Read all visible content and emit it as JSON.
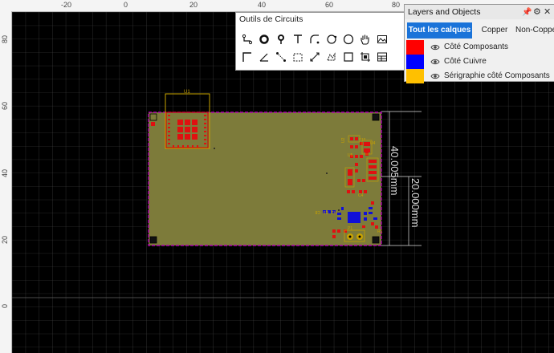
{
  "ruler": {
    "top_ticks": [
      "-20",
      "0",
      "20",
      "40",
      "60",
      "80"
    ],
    "left_ticks": [
      "80",
      "60",
      "40",
      "20",
      "0"
    ]
  },
  "tools_panel": {
    "title": "Outils de Circuits",
    "tools": [
      {
        "name": "wire-tool",
        "icon": "wire-icon"
      },
      {
        "name": "pad-tool",
        "icon": "ring-icon"
      },
      {
        "name": "via-tool",
        "icon": "via-icon"
      },
      {
        "name": "text-tool",
        "icon": "text-icon"
      },
      {
        "name": "arc-tool",
        "icon": "arc-icon"
      },
      {
        "name": "circle-tool",
        "icon": "circle-icon"
      },
      {
        "name": "filled-circle-tool",
        "icon": "circle-outline-icon"
      },
      {
        "name": "pan-tool",
        "icon": "hand-icon"
      },
      {
        "name": "image-tool",
        "icon": "image-icon"
      },
      {
        "name": "line-tool",
        "icon": "corner-line-icon"
      },
      {
        "name": "angle-tool",
        "icon": "angle-icon"
      },
      {
        "name": "measure-tool",
        "icon": "measure-icon"
      },
      {
        "name": "select-area-tool",
        "icon": "select-rect-icon"
      },
      {
        "name": "dimension-tool",
        "icon": "dimension-icon"
      },
      {
        "name": "copper-area-tool",
        "icon": "area-icon"
      },
      {
        "name": "rect-tool",
        "icon": "rect-icon"
      },
      {
        "name": "crop-tool",
        "icon": "crop-icon"
      },
      {
        "name": "table-tool",
        "icon": "table-icon"
      }
    ]
  },
  "layers_panel": {
    "title": "Layers and Objects",
    "tabs": [
      "Tout les calques",
      "Copper",
      "Non-Copper"
    ],
    "active_tab": 0,
    "layers": [
      {
        "label": "Côté Composants",
        "color": "#ff0000"
      },
      {
        "label": "Côté Cuivre",
        "color": "#0000ff"
      },
      {
        "label": "Sérigraphie côté Composants",
        "color": "#ffc000"
      }
    ]
  },
  "board": {
    "dim_vertical_total": "40.005mm",
    "dim_vertical_half": "20.000mm",
    "labels": [
      "U1",
      "U2",
      "U4",
      "C10",
      "U5",
      "C4",
      "C8",
      "R2",
      "C9",
      "R1",
      "P1"
    ]
  }
}
